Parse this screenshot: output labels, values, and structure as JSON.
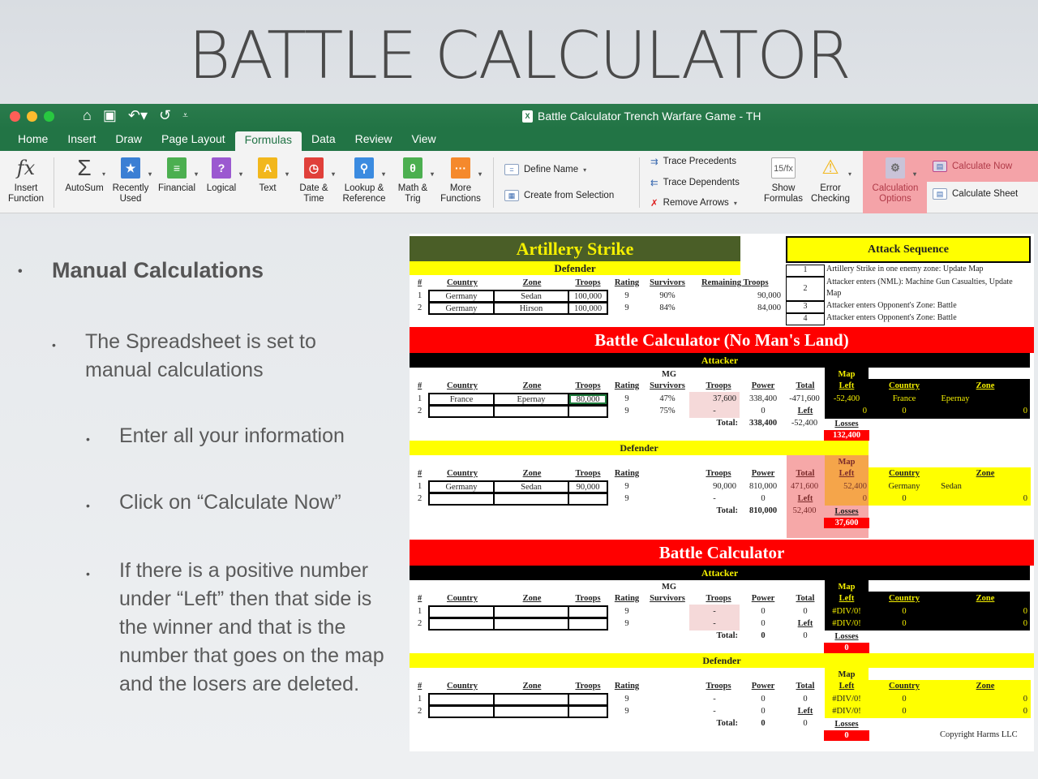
{
  "slide": {
    "title": "BATTLE CALCULATOR",
    "bullets": [
      {
        "level": 1,
        "text": "Manual Calculations"
      },
      {
        "level": 2,
        "text": "The Spreadsheet is set to manual calculations"
      },
      {
        "level": 3,
        "text": "Enter all your information"
      },
      {
        "level": 3,
        "text": "Click on “Calculate Now”"
      },
      {
        "level": 3,
        "text": "If there is a positive number under “Left” then that side is the winner and that is the number that goes on the map and the losers are deleted."
      }
    ]
  },
  "excel": {
    "window_title": "Battle Calculator Trench Warfare Game - TH",
    "quick_access": [
      "home-icon",
      "save-icon",
      "undo-icon",
      "redo-icon",
      "customize-icon"
    ],
    "tabs": [
      "Home",
      "Insert",
      "Draw",
      "Page Layout",
      "Formulas",
      "Data",
      "Review",
      "View"
    ],
    "active_tab": "Formulas",
    "ribbon": {
      "insert_function": "Insert Function",
      "autosum": "AutoSum",
      "recently_used": "Recently Used",
      "financial": "Financial",
      "logical": "Logical",
      "text": "Text",
      "date_time": "Date & Time",
      "lookup_reference": "Lookup & Reference",
      "math_trig": "Math & Trig",
      "more_functions": "More Functions",
      "define_name": "Define Name",
      "create_from_selection": "Create from Selection",
      "trace_precedents": "Trace Precedents",
      "trace_dependents": "Trace Dependents",
      "remove_arrows": "Remove Arrows",
      "show_formulas": "Show Formulas",
      "error_checking": "Error Checking",
      "calculation_options": "Calculation Options",
      "calculate_now": "Calculate Now",
      "calculate_sheet": "Calculate Sheet"
    },
    "colors": {
      "excel_green": "#227445",
      "highlight": "#f4a3a8"
    }
  },
  "sheet": {
    "artillery": {
      "title": "Artillery Strike",
      "band": "Defender",
      "headers": [
        "#",
        "Country",
        "Zone",
        "Troops",
        "Rating",
        "Survivors",
        "Remaining Troops"
      ],
      "rows": [
        [
          "1",
          "Germany",
          "Sedan",
          "100,000",
          "9",
          "90%",
          "90,000"
        ],
        [
          "2",
          "Germany",
          "Hirson",
          "100,000",
          "9",
          "84%",
          "84,000"
        ]
      ]
    },
    "attack_sequence": {
      "title": "Attack Sequence",
      "items": [
        {
          "n": "1",
          "text": "Artillery Strike in one enemy zone: Update Map"
        },
        {
          "n": "2",
          "text": "Attacker enters (NML): Machine Gun Casualties, Update Map"
        },
        {
          "n": "3",
          "text": "Attacker enters Opponent's Zone: Battle"
        },
        {
          "n": "4",
          "text": "Attacker enters Opponent's Zone: Battle"
        }
      ]
    },
    "nml": {
      "title": "Battle Calculator (No Man's Land)",
      "attacker": {
        "band": "Attacker",
        "headers": [
          "#",
          "Country",
          "Zone",
          "Troops",
          "Rating",
          "MG Survivors",
          "Troops",
          "Power",
          "Total"
        ],
        "rows": [
          [
            "1",
            "France",
            "Epernay",
            "80,000",
            "9",
            "47%",
            "37,600",
            "338,400",
            "-471,600"
          ],
          [
            "2",
            "",
            "",
            "",
            "9",
            "75%",
            "-",
            "0",
            ""
          ]
        ],
        "left_label": "Left",
        "total_label": "Total:",
        "total_power": "338,400",
        "left_value": "-52,400",
        "map_header": "Map Left",
        "map_headers": [
          "Country",
          "Zone"
        ],
        "map_rows": [
          [
            "-52,400",
            "France",
            "Epernay",
            ""
          ],
          [
            "0",
            "0",
            "",
            "0"
          ]
        ],
        "losses_label": "Losses",
        "losses": "132,400"
      },
      "defender": {
        "band": "Defender",
        "headers": [
          "#",
          "Country",
          "Zone",
          "Troops",
          "Rating",
          "Troops",
          "Power",
          "Total"
        ],
        "rows": [
          [
            "1",
            "Germany",
            "Sedan",
            "90,000",
            "9",
            "90,000",
            "810,000",
            "471,600"
          ],
          [
            "2",
            "",
            "",
            "",
            "9",
            "-",
            "0",
            ""
          ]
        ],
        "left_label": "Left",
        "total_label": "Total:",
        "total_power": "810,000",
        "left_value": "52,400",
        "map_header": "Map Left",
        "map_headers": [
          "Country",
          "Zone"
        ],
        "map_rows": [
          [
            "52,400",
            "Germany",
            "Sedan",
            ""
          ],
          [
            "0",
            "0",
            "",
            "0"
          ]
        ],
        "losses_label": "Losses",
        "losses": "37,600"
      }
    },
    "battle": {
      "title": "Battle Calculator",
      "attacker": {
        "band": "Attacker",
        "rows": [
          [
            "1",
            "",
            "",
            "",
            "9",
            "",
            "-",
            "0",
            "0"
          ],
          [
            "2",
            "",
            "",
            "",
            "9",
            "",
            "-",
            "0",
            ""
          ]
        ],
        "total_power": "0",
        "left_value": "0",
        "map_rows": [
          [
            "#DIV/0!",
            "0",
            "",
            "0"
          ],
          [
            "#DIV/0!",
            "0",
            "",
            "0"
          ]
        ],
        "losses": "0"
      },
      "defender": {
        "band": "Defender",
        "rows": [
          [
            "1",
            "",
            "",
            "",
            "9",
            "-",
            "0",
            "0"
          ],
          [
            "2",
            "",
            "",
            "",
            "9",
            "-",
            "0",
            ""
          ]
        ],
        "total_power": "0",
        "left_value": "0",
        "map_rows": [
          [
            "#DIV/0!",
            "0",
            "",
            "0"
          ],
          [
            "#DIV/0!",
            "0",
            "",
            "0"
          ]
        ],
        "losses": "0"
      }
    },
    "copyright": "Copyright Harms LLC"
  }
}
